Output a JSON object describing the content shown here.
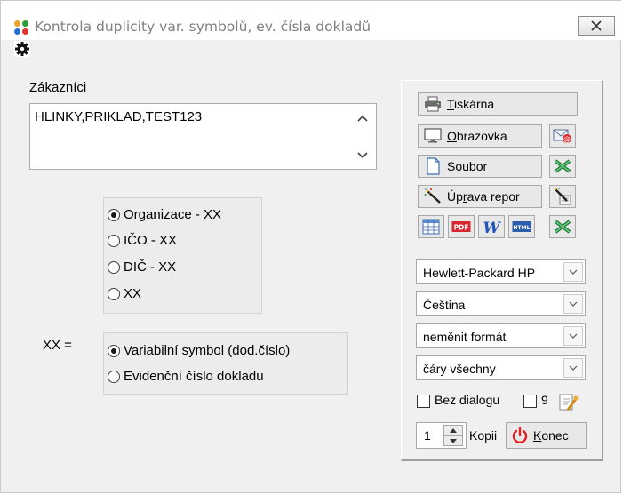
{
  "window": {
    "title": "Kontrola duplicity var. symbolů, ev. čísla dokladů"
  },
  "customers": {
    "label": "Zákazníci",
    "value": "HLINKY,PRIKLAD,TEST123"
  },
  "group1": {
    "options": [
      "Organizace - XX",
      "IČO - XX",
      "DIČ - XX",
      "XX"
    ],
    "selected_index": 0
  },
  "group2": {
    "label": "XX =",
    "options": [
      "Variabilní symbol (dod.číslo)",
      "Evidenční číslo dokladu"
    ],
    "selected_index": 0
  },
  "panel": {
    "printer_btn": {
      "mnemonic": "T",
      "rest": "iskárna"
    },
    "screen_btn": {
      "mnemonic": "O",
      "rest": "brazovka"
    },
    "file_btn": {
      "mnemonic": "S",
      "rest": "oubor"
    },
    "edit_btn": {
      "pre": "Úp",
      "mnemonic": "r",
      "rest": "ava repor"
    },
    "printer_select": "Hewlett-Packard HP",
    "language_select": "Čeština",
    "format_select": "neměnit formát",
    "lines_select": "čáry všechny",
    "no_dialog_label": "Bez dialogu",
    "nine_label": "9",
    "copies_value": "1",
    "copies_label": "Kopii",
    "end_btn": {
      "mnemonic": "K",
      "rest": "onec"
    },
    "pdf_text": "PDF",
    "html_text": "HTML",
    "word_text": "W"
  },
  "colors": {
    "excel_green": "#1e7a3a",
    "pdf_red": "#d7262e",
    "word_blue": "#1f56b8",
    "power_red": "#e02020",
    "mail_red": "#d62828"
  }
}
